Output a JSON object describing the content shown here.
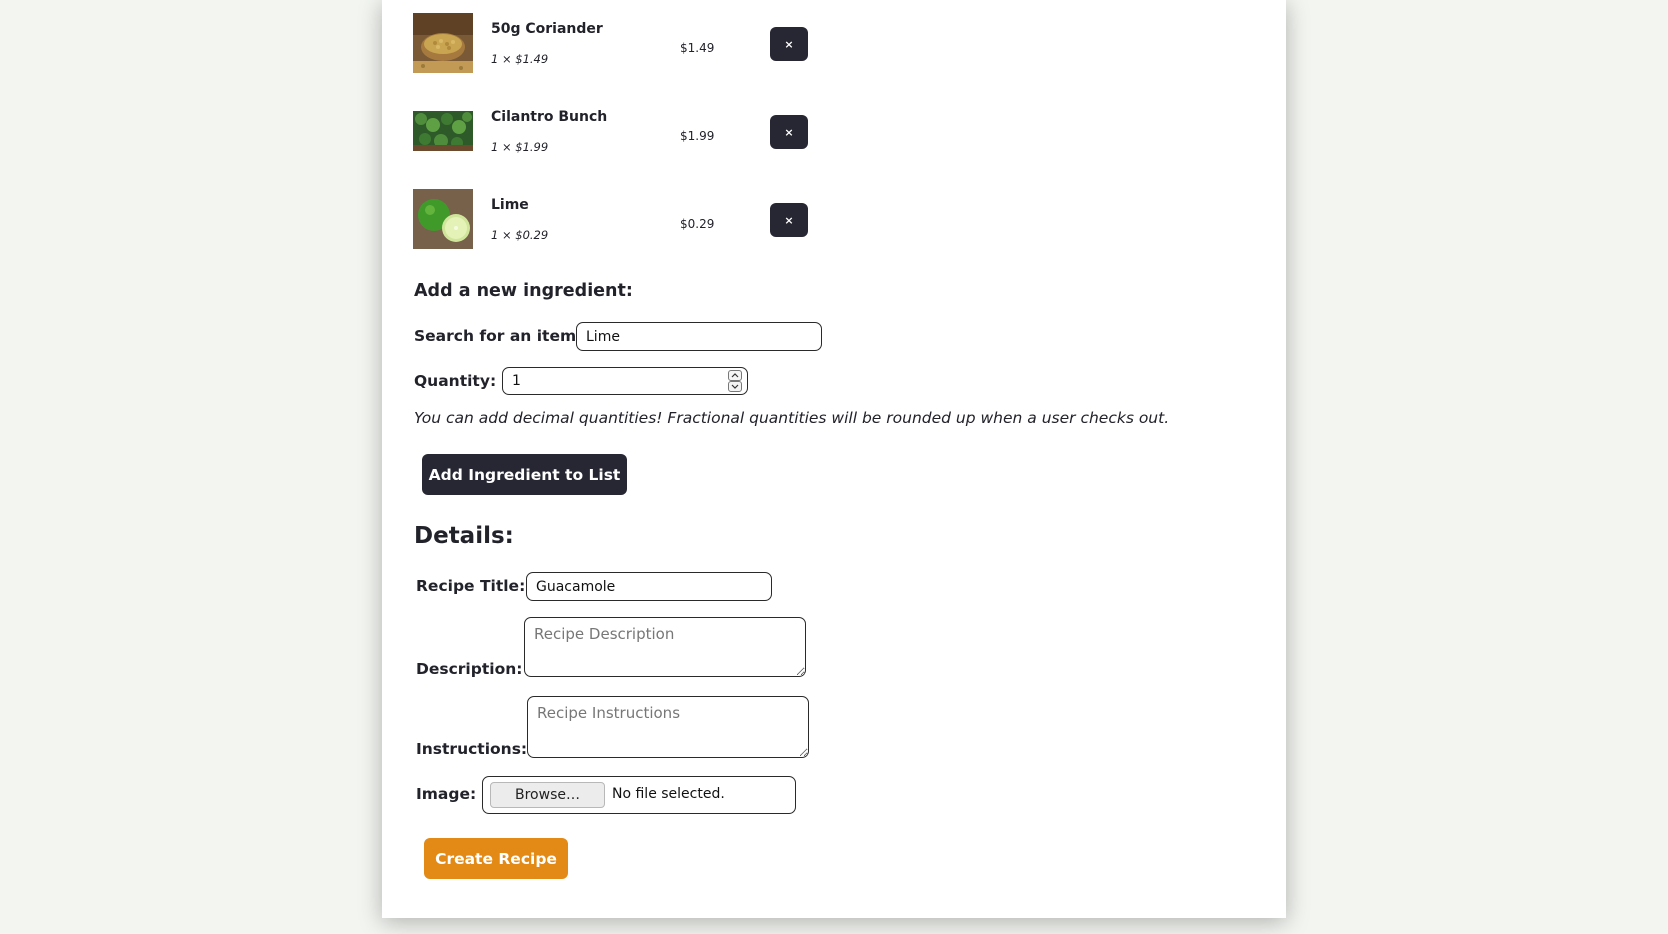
{
  "colors": {
    "page_background": "#f3f5f1",
    "card_background": "#ffffff",
    "dark_button": "#272733",
    "accent_orange": "#e38a16",
    "text": "#22222b"
  },
  "ingredients": {
    "items": [
      {
        "name": "50g Coriander",
        "quantity_text": "1 × $1.49",
        "price": "$1.49",
        "remove_label": "×",
        "image_icon": "coriander-seeds-photo"
      },
      {
        "name": "Cilantro Bunch",
        "quantity_text": "1 × $1.99",
        "price": "$1.99",
        "remove_label": "×",
        "image_icon": "cilantro-photo"
      },
      {
        "name": "Lime",
        "quantity_text": "1 × $0.29",
        "price": "$0.29",
        "remove_label": "×",
        "image_icon": "lime-photo"
      }
    ]
  },
  "add_ingredient": {
    "heading": "Add a new ingredient:",
    "search_label": "Search for an item:",
    "search_value": "Lime",
    "quantity_label": "Quantity:",
    "quantity_value": "1",
    "hint": "You can add decimal quantities! Fractional quantities will be rounded up when a user checks out.",
    "add_button_label": "Add Ingredient to List"
  },
  "details": {
    "heading": "Details:",
    "title_label": "Recipe Title:",
    "title_value": "Guacamole",
    "description_label": "Description:",
    "description_placeholder": "Recipe Description",
    "instructions_label": "Instructions:",
    "instructions_placeholder": "Recipe Instructions",
    "image_label": "Image:",
    "browse_label": "Browse…",
    "file_status": "No file selected.",
    "create_button_label": "Create Recipe"
  }
}
